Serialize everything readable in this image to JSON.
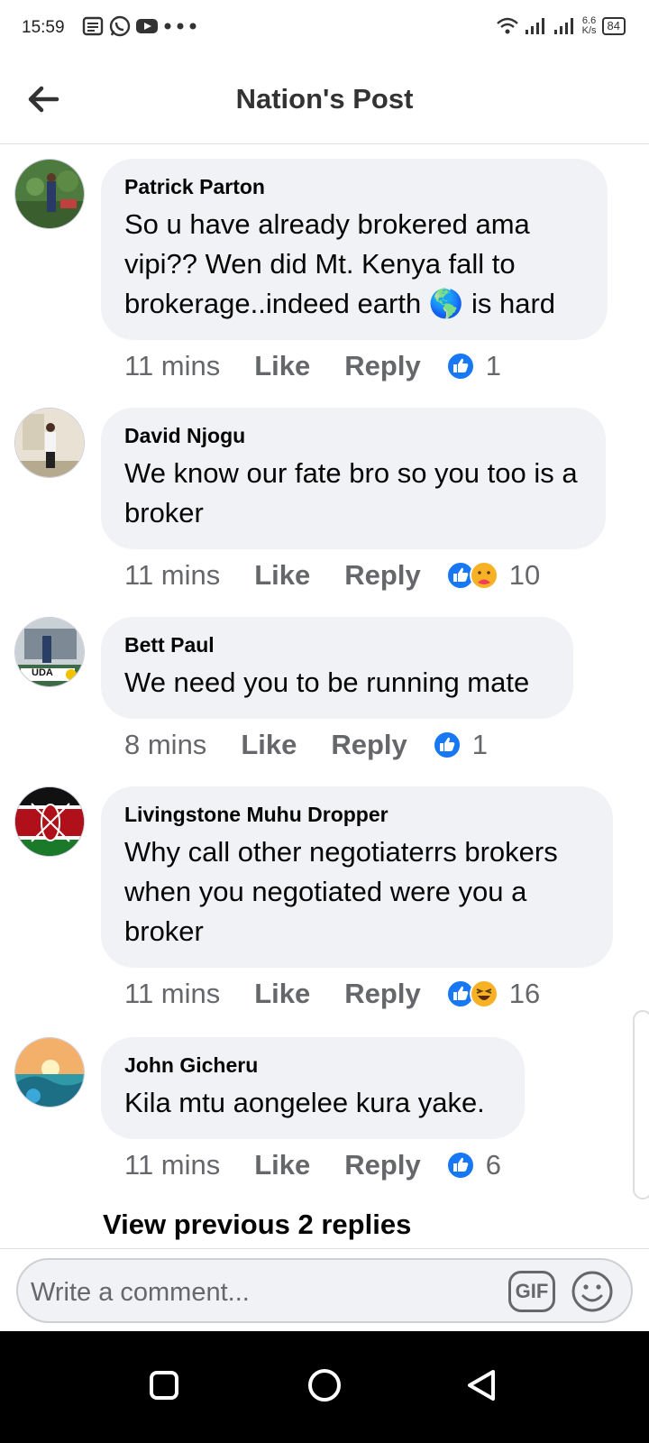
{
  "status_bar": {
    "time": "15:59",
    "left_icons": [
      "news-icon",
      "whatsapp-icon",
      "youtube-icon",
      "more-dots-icon"
    ],
    "net_speed_value": "6.6",
    "net_speed_unit": "K/s",
    "battery": "84"
  },
  "header": {
    "title": "Nation's Post",
    "back_icon": "arrow-left-icon"
  },
  "comments": [
    {
      "author": "Patrick Parton",
      "text": "So u have already brokered ama vipi?? Wen did Mt. Kenya fall to brokerage..indeed earth 🌎 is hard",
      "time": "11 mins",
      "like_label": "Like",
      "reply_label": "Reply",
      "reactions": [
        "like"
      ],
      "reaction_count": "1"
    },
    {
      "author": "David Njogu",
      "text": "We know our fate bro so you too is a broker",
      "time": "11 mins",
      "like_label": "Like",
      "reply_label": "Reply",
      "reactions": [
        "like",
        "care"
      ],
      "reaction_count": "10"
    },
    {
      "author": "Bett Paul",
      "text": "We need you to be running mate",
      "time": "8 mins",
      "like_label": "Like",
      "reply_label": "Reply",
      "reactions": [
        "like"
      ],
      "reaction_count": "1"
    },
    {
      "author": "Livingstone Muhu Dropper",
      "text": "Why call other negotiaterrs brokers when you negotiated were you a broker",
      "time": "11 mins",
      "like_label": "Like",
      "reply_label": "Reply",
      "reactions": [
        "like",
        "haha"
      ],
      "reaction_count": "16"
    },
    {
      "author": "John Gicheru",
      "text": "Kila mtu aongelee kura yake.",
      "time": "11 mins",
      "like_label": "Like",
      "reply_label": "Reply",
      "reactions": [
        "like"
      ],
      "reaction_count": "6"
    }
  ],
  "view_previous": "View previous 2 replies",
  "composer": {
    "placeholder": "Write a comment...",
    "gif_label": "GIF",
    "emoji_icon": "smiley-icon"
  },
  "avatar_badge": "UDA",
  "colors": {
    "like_blue": "#1877f2",
    "bubble_bg": "#f0f2f5",
    "meta_gray": "#65676b"
  }
}
